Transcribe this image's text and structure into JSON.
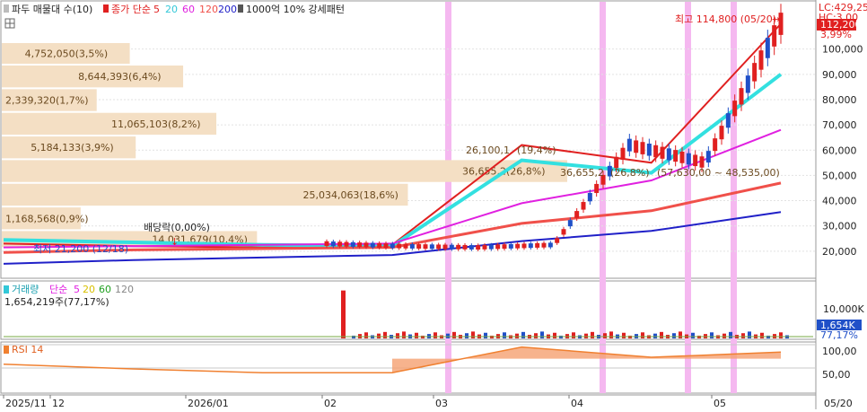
{
  "legend": {
    "price": {
      "title": "파두 매물대 수(10)",
      "ma_label": "종가 단순",
      "periods": [
        "5",
        "20",
        "60",
        "120",
        "200"
      ],
      "pattern": "1000억 10% 강세패턴"
    },
    "volume": {
      "title": "거래량",
      "ma_label": "단순",
      "periods": [
        "5",
        "20",
        "60",
        "120"
      ],
      "summary": "1,654,219주(77,17%)"
    },
    "rsi": {
      "title": "RSI 14"
    }
  },
  "top_right": {
    "lc": "LC:429,25",
    "hc": "HC:3,00",
    "price_tag": "112,200",
    "change_pct": "3,99%"
  },
  "axis": {
    "price_ticks": [
      "100,000",
      "90,000",
      "80,000",
      "70,000",
      "60,000",
      "50,000",
      "40,000",
      "30,000",
      "20,000"
    ],
    "volume_ticks": [
      "10,000K"
    ],
    "volume_tag": "1,654K",
    "volume_pct": "77,17%",
    "rsi_ticks": [
      "100,00",
      "50,00"
    ],
    "date_ticks": [
      "2025/11",
      "12",
      "2026/01",
      "02",
      "03",
      "04",
      "05"
    ],
    "cursor_date": "05/20"
  },
  "annotations": {
    "high": "최고 114,800 (05/20)",
    "low": "최저 21,200 (12/18)",
    "dividend": "배당락(0,00%)",
    "current_range": "36,655,2",
    "current_range_pct": "(26,8%)",
    "price_band": "(57,630,00 ~ 48,535,00)",
    "current_overlay": "26,100,1",
    "current_overlay_pct": "(19,4%)"
  },
  "chart_data": [
    {
      "type": "bar",
      "name": "price-volume-profile",
      "y_range": [
        21200,
        114800
      ],
      "zones": [
        {
          "label": "4,752,050(3,5%)",
          "low": 93840,
          "high": 102720,
          "value": 4752050
        },
        {
          "label": "8,644,393(6,4%)",
          "low": 84480,
          "high": 93840,
          "value": 8644393
        },
        {
          "label": "2,339,320(1,7%)",
          "low": 75120,
          "high": 84480,
          "value": 2339320
        },
        {
          "label": "11,065,103(8,2%)",
          "low": 65760,
          "high": 75120,
          "value": 11065103
        },
        {
          "label": "5,184,133(3,9%)",
          "low": 56400,
          "high": 65760,
          "value": 5184133
        },
        {
          "label": "36,655,2(26,8%)",
          "low": 47040,
          "high": 56400,
          "value": 36655200
        },
        {
          "label": "25,034,063(18,6%)",
          "low": 37680,
          "high": 47040,
          "value": 25034063
        },
        {
          "label": "1,168,568(0,9%)",
          "low": 28320,
          "high": 37680,
          "value": 1168568
        },
        {
          "label": "14,031,679(10,4%)",
          "low": 21200,
          "high": 28320,
          "value": 14031679
        }
      ]
    },
    {
      "type": "line",
      "name": "price-moving-averages",
      "x": [
        "2025/11",
        "12",
        "2026/01",
        "02",
        "03",
        "04",
        "05/20"
      ],
      "ylim": [
        10000,
        118000
      ],
      "series": [
        {
          "name": "5",
          "color": "#e02020",
          "values": [
            23000,
            22000,
            21500,
            22500,
            62000,
            55000,
            110000
          ]
        },
        {
          "name": "20",
          "color": "#33e0e0",
          "values": [
            24500,
            23500,
            22500,
            22000,
            56000,
            51000,
            90000
          ]
        },
        {
          "name": "60",
          "color": "#e020e0",
          "values": [
            21500,
            22000,
            22500,
            23000,
            39000,
            48000,
            68000
          ]
        },
        {
          "name": "120",
          "color": "#f0504a",
          "values": [
            19500,
            20500,
            21000,
            21500,
            31000,
            36000,
            47000
          ]
        },
        {
          "name": "200",
          "color": "#2020c8",
          "values": [
            15000,
            16500,
            17500,
            18500,
            24000,
            28000,
            35500
          ]
        }
      ]
    },
    {
      "type": "bar",
      "name": "daily-volume",
      "ylim": [
        0,
        16000000
      ],
      "categories": [
        "2026/02/10"
      ],
      "values": [
        14000000
      ],
      "last_value": 1654219,
      "note": "peak volume bar near early 02"
    },
    {
      "type": "line",
      "name": "rsi-14",
      "ylim": [
        0,
        100
      ],
      "x": [
        "2025/11",
        "12",
        "2026/01",
        "02",
        "03",
        "04",
        "05/20"
      ],
      "series": [
        {
          "name": "RSI 14",
          "color": "#f08030",
          "values": [
            58,
            48,
            40,
            40,
            95,
            73,
            84
          ]
        }
      ]
    }
  ],
  "colors": {
    "up": "#e02020",
    "down": "#2050c8",
    "profile_fill": "#f4dfc4",
    "highlight_band": "#f5b8f0",
    "rsi_fill": "#f5a070"
  }
}
